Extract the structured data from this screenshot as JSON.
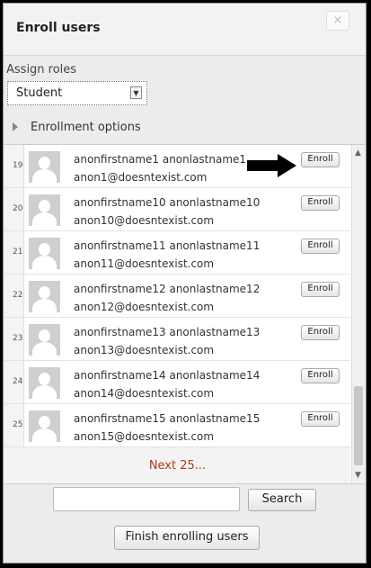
{
  "dialog": {
    "title": "Enroll users",
    "close_label": "×"
  },
  "roles": {
    "label": "Assign roles",
    "selected": "Student"
  },
  "options": {
    "label": "Enrollment options"
  },
  "users": [
    {
      "num": "19",
      "name": "anonfirstname1 anonlastname1",
      "email": "anon1@doesntexist.com",
      "button": "Enroll"
    },
    {
      "num": "20",
      "name": "anonfirstname10 anonlastname10",
      "email": "anon10@doesntexist.com",
      "button": "Enroll"
    },
    {
      "num": "21",
      "name": "anonfirstname11 anonlastname11",
      "email": "anon11@doesntexist.com",
      "button": "Enroll"
    },
    {
      "num": "22",
      "name": "anonfirstname12 anonlastname12",
      "email": "anon12@doesntexist.com",
      "button": "Enroll"
    },
    {
      "num": "23",
      "name": "anonfirstname13 anonlastname13",
      "email": "anon13@doesntexist.com",
      "button": "Enroll"
    },
    {
      "num": "24",
      "name": "anonfirstname14 anonlastname14",
      "email": "anon14@doesntexist.com",
      "button": "Enroll"
    },
    {
      "num": "25",
      "name": "anonfirstname15 anonlastname15",
      "email": "anon15@doesntexist.com",
      "button": "Enroll"
    }
  ],
  "pagination": {
    "next_label": "Next 25..."
  },
  "search": {
    "value": "",
    "button_label": "Search"
  },
  "footer": {
    "finish_label": "Finish enrolling users"
  },
  "colors": {
    "next_link": "#b03a1f",
    "annotation_arrow": "#000000"
  }
}
